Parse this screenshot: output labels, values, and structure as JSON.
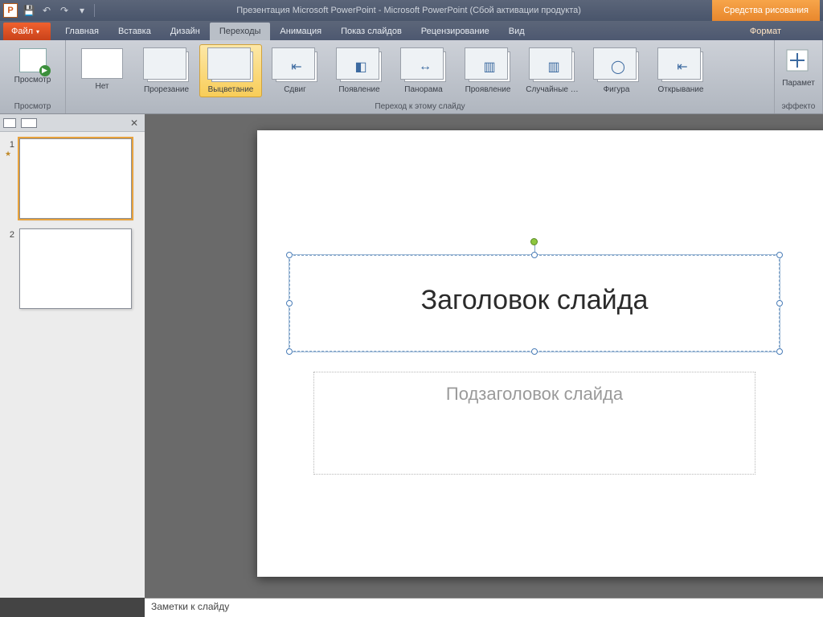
{
  "titlebar": {
    "app_title": "Презентация Microsoft PowerPoint  -  Microsoft PowerPoint (Сбой активации продукта)",
    "app_letter": "P",
    "context_tools": "Средства рисования"
  },
  "tabs": {
    "file": "Файл",
    "items": [
      "Главная",
      "Вставка",
      "Дизайн",
      "Переходы",
      "Анимация",
      "Показ слайдов",
      "Рецензирование",
      "Вид"
    ],
    "context": "Формат",
    "active_index": 3
  },
  "ribbon": {
    "preview_group": {
      "label": "Просмотр",
      "preview_btn": "Просмотр"
    },
    "transitions_group": {
      "label": "Переход к этому слайду",
      "items": [
        "Нет",
        "Прорезание",
        "Выцветание",
        "Сдвиг",
        "Появление",
        "Панорама",
        "Проявление",
        "Случайные …",
        "Фигура",
        "Открывание"
      ],
      "selected_index": 2
    },
    "effect_group": {
      "btn": "Парамет",
      "label": "эффекто"
    }
  },
  "thumbs": {
    "slides": [
      {
        "num": "1",
        "starred": true
      },
      {
        "num": "2",
        "starred": false
      }
    ]
  },
  "slide": {
    "title": "Заголовок слайда",
    "subtitle": "Подзаголовок слайда"
  },
  "notes": {
    "placeholder": "Заметки к слайду"
  }
}
